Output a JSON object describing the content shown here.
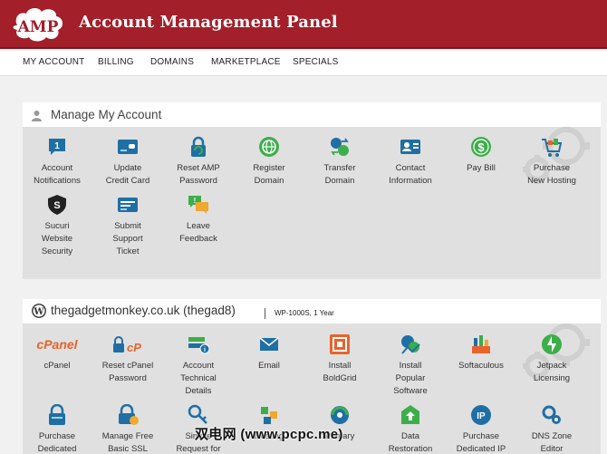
{
  "header": {
    "logo_text": "AMP",
    "title": "Account Management Panel"
  },
  "nav": [
    {
      "label": "MY ACCOUNT"
    },
    {
      "label": "BILLING"
    },
    {
      "label": "DOMAINS"
    },
    {
      "label": "MARKETPLACE"
    },
    {
      "label": "SPECIALS"
    }
  ],
  "account_panel": {
    "title": "Manage My Account",
    "icon": "user-icon",
    "tiles": [
      {
        "label": "Account\nNotifications",
        "icon": "notification-icon"
      },
      {
        "label": "Update\nCredit Card",
        "icon": "credit-card-icon"
      },
      {
        "label": "Reset AMP\nPassword",
        "icon": "lock-reset-icon"
      },
      {
        "label": "Register\nDomain",
        "icon": "globe-icon"
      },
      {
        "label": "Transfer\nDomain",
        "icon": "transfer-icon"
      },
      {
        "label": "Contact\nInformation",
        "icon": "contact-card-icon"
      },
      {
        "label": "Pay Bill",
        "icon": "dollar-icon"
      },
      {
        "label": "Purchase\nNew Hosting",
        "icon": "shopping-cart-icon"
      },
      {
        "label": "Sucuri\nWebsite\nSecurity",
        "icon": "shield-icon"
      },
      {
        "label": "Submit\nSupport\nTicket",
        "icon": "ticket-icon"
      },
      {
        "label": "Leave\nFeedback",
        "icon": "feedback-icon"
      }
    ]
  },
  "hosting_panel": {
    "title": "thegadgetmonkey.co.uk (thegad8)",
    "icon": "wordpress-icon",
    "plan": "WP-1000S, 1 Year",
    "tiles": [
      {
        "label": "cPanel",
        "icon": "cpanel-logo-icon"
      },
      {
        "label": "Reset cPanel\nPassword",
        "icon": "lock-cpanel-icon"
      },
      {
        "label": "Account\nTechnical\nDetails",
        "icon": "server-info-icon"
      },
      {
        "label": "Email",
        "icon": "envelope-icon"
      },
      {
        "label": "Install\nBoldGrid",
        "icon": "boldgrid-icon"
      },
      {
        "label": "Install\nPopular\nSoftware",
        "icon": "software-icon"
      },
      {
        "label": "Softaculous",
        "icon": "softaculous-icon"
      },
      {
        "label": "Jetpack\nLicensing",
        "icon": "jetpack-icon"
      },
      {
        "label": "Purchase\nDedicated",
        "icon": "lock-purchase-icon"
      },
      {
        "label": "Manage Free\nBasic SSL",
        "icon": "ssl-icon"
      },
      {
        "label": "Simple\nRequest for",
        "icon": "key-icon"
      },
      {
        "label": "Hosting",
        "icon": "hosting-icon"
      },
      {
        "label": "Primary",
        "icon": "primary-domain-icon"
      },
      {
        "label": "Data\nRestoration",
        "icon": "data-restore-icon"
      },
      {
        "label": "Purchase\nDedicated IP",
        "icon": "ip-icon"
      },
      {
        "label": "DNS Zone\nEditor",
        "icon": "dns-gear-icon"
      }
    ]
  },
  "watermark": "双电网 (www.pcpc.me)",
  "colors": {
    "header_bg": "#a31f2a",
    "panel_bg": "#e0e0e0",
    "icon_blue": "#1f6fa5",
    "icon_green": "#3cae4a",
    "icon_orange": "#e8632a"
  }
}
